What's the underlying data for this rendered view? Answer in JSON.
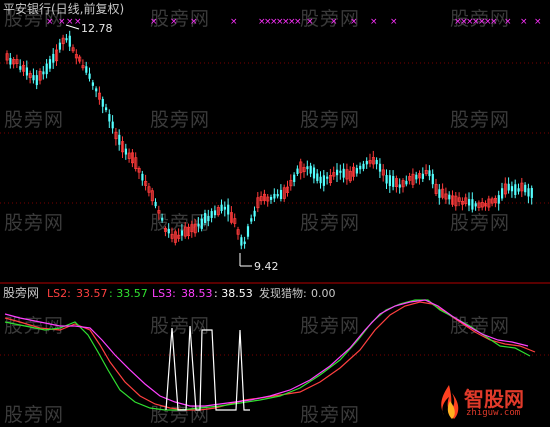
{
  "top_panel": {
    "stock_title": "平安银行(日线,前复权)",
    "high_label": "12.78",
    "low_label": "9.42"
  },
  "sub_panel": {
    "indicator_name": "股旁网",
    "ls2_label": "LS2:",
    "ls2_value": "33.57",
    "sep_value": ": 33.57",
    "ls3_label": "LS3:",
    "ls3_value": "38.53",
    "ls3_second": ": 38.53",
    "found_label": "发现猎物:",
    "found_value": "0.00"
  },
  "watermark": "股旁网",
  "logo": {
    "name": "智股网",
    "url": "zhiguw.com"
  },
  "colors": {
    "background": "#000000",
    "up_candle": "#ff3b3b",
    "down_candle": "#54ffff",
    "title": "#c8c8c8",
    "ls2": "#ff4040",
    "green_line": "#30e030",
    "ls3": "#ff40ff",
    "white_line": "#ffffff",
    "divider": "#b40000",
    "marker": "#ff30ff"
  }
}
